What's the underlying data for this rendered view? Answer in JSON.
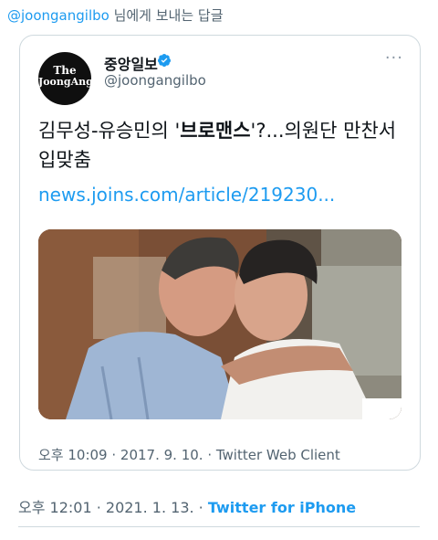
{
  "reply": {
    "handle": "@joongangilbo",
    "suffix": " 님에게 보내는 답글"
  },
  "quoted": {
    "avatar_line1": "The",
    "avatar_line2": "JoongAng",
    "name": "중앙일보",
    "username": "@joongangilbo",
    "more_icon": "···",
    "text_part1": "김무성-유승민의 '",
    "text_bold": "브로맨스",
    "text_part2": "'?...의원단 만찬서 입맞춤",
    "link": "news.joins.com/article/219230...",
    "timestamp": "오후 10:09 · 2017. 9. 10. · Twitter Web Client"
  },
  "tweet": {
    "time": "오후 12:01 · 2021. 1. 13. · ",
    "client": "Twitter for iPhone"
  },
  "colors": {
    "accent": "#1d9bf0",
    "muted": "#536471",
    "border": "#cfd9de"
  }
}
